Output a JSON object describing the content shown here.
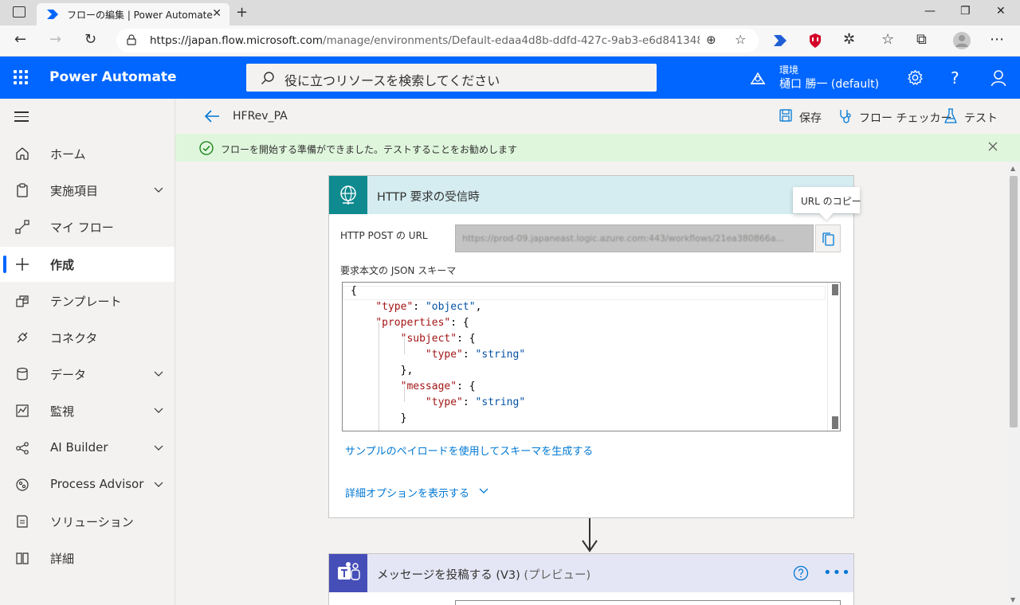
{
  "browser": {
    "tab_title": "フローの編集 | Power Automate",
    "url_host": "https://japan.flow.microsoft.com",
    "url_path": "/manage/environments/Default-edaa4d8b-ddfd-427c-9ab3-e6d841348b94/..."
  },
  "header": {
    "app_name": "Power Automate",
    "search_placeholder": "役に立つリソースを検索してください",
    "env_label": "環境",
    "env_name": "樋口 勝一 (default)"
  },
  "nav": {
    "items": [
      {
        "label": "ホーム",
        "icon": "home-icon",
        "has_chevron": false,
        "active": false
      },
      {
        "label": "実施項目",
        "icon": "clipboard-icon",
        "has_chevron": true,
        "active": false
      },
      {
        "label": "マイ フロー",
        "icon": "flow-icon",
        "has_chevron": false,
        "active": false
      },
      {
        "label": "作成",
        "icon": "plus-icon",
        "has_chevron": false,
        "active": true
      },
      {
        "label": "テンプレート",
        "icon": "template-icon",
        "has_chevron": false,
        "active": false
      },
      {
        "label": "コネクタ",
        "icon": "connector-icon",
        "has_chevron": false,
        "active": false
      },
      {
        "label": "データ",
        "icon": "database-icon",
        "has_chevron": true,
        "active": false
      },
      {
        "label": "監視",
        "icon": "monitor-icon",
        "has_chevron": true,
        "active": false
      },
      {
        "label": "AI Builder",
        "icon": "ai-builder-icon",
        "has_chevron": true,
        "active": false
      },
      {
        "label": "Process Advisor",
        "icon": "process-advisor-icon",
        "has_chevron": true,
        "active": false
      },
      {
        "label": "ソリューション",
        "icon": "solution-icon",
        "has_chevron": false,
        "active": false
      },
      {
        "label": "詳細",
        "icon": "book-icon",
        "has_chevron": false,
        "active": false
      }
    ]
  },
  "command_bar": {
    "flow_name": "HFRev_PA",
    "save": "保存",
    "flow_checker": "フロー チェッカー",
    "test": "テスト"
  },
  "banner": {
    "text": "フローを開始する準備ができました。テストすることをお勧めします"
  },
  "trigger_card": {
    "title": "HTTP 要求の受信時",
    "url_label": "HTTP POST の URL",
    "url_value": "https://prod-09.japaneast.logic.azure.com:443/workflows/21ea380866a...",
    "copy_tooltip": "URL のコピー",
    "schema_label": "要求本文の JSON スキーマ",
    "schema_lines": [
      {
        "pre": "{",
        "key": "",
        "mid": "",
        "val": "",
        "post": ""
      },
      {
        "pre": "    ",
        "key": "\"type\"",
        "mid": ": ",
        "val": "\"object\"",
        "post": ","
      },
      {
        "pre": "    ",
        "key": "\"properties\"",
        "mid": ": {",
        "val": "",
        "post": ""
      },
      {
        "pre": "        ",
        "key": "\"subject\"",
        "mid": ": {",
        "val": "",
        "post": ""
      },
      {
        "pre": "            ",
        "key": "\"type\"",
        "mid": ": ",
        "val": "\"string\"",
        "post": ""
      },
      {
        "pre": "        },",
        "key": "",
        "mid": "",
        "val": "",
        "post": ""
      },
      {
        "pre": "        ",
        "key": "\"message\"",
        "mid": ": {",
        "val": "",
        "post": ""
      },
      {
        "pre": "            ",
        "key": "\"type\"",
        "mid": ": ",
        "val": "\"string\"",
        "post": ""
      },
      {
        "pre": "        }",
        "key": "",
        "mid": "",
        "val": "",
        "post": ""
      }
    ],
    "generate_link": "サンプルのペイロードを使用してスキーマを生成する",
    "advanced_link": "詳細オプションを表示する"
  },
  "action_card": {
    "title": "メッセージを投稿する (V3)",
    "title_suffix": "(プレビュー)"
  },
  "colors": {
    "accent": "#0066ff",
    "trigger_head": "#d5edf1",
    "trigger_icon": "#0f8a8f",
    "teams_icon": "#464eb8",
    "link": "#0078d4",
    "banner": "#dff6dd"
  }
}
